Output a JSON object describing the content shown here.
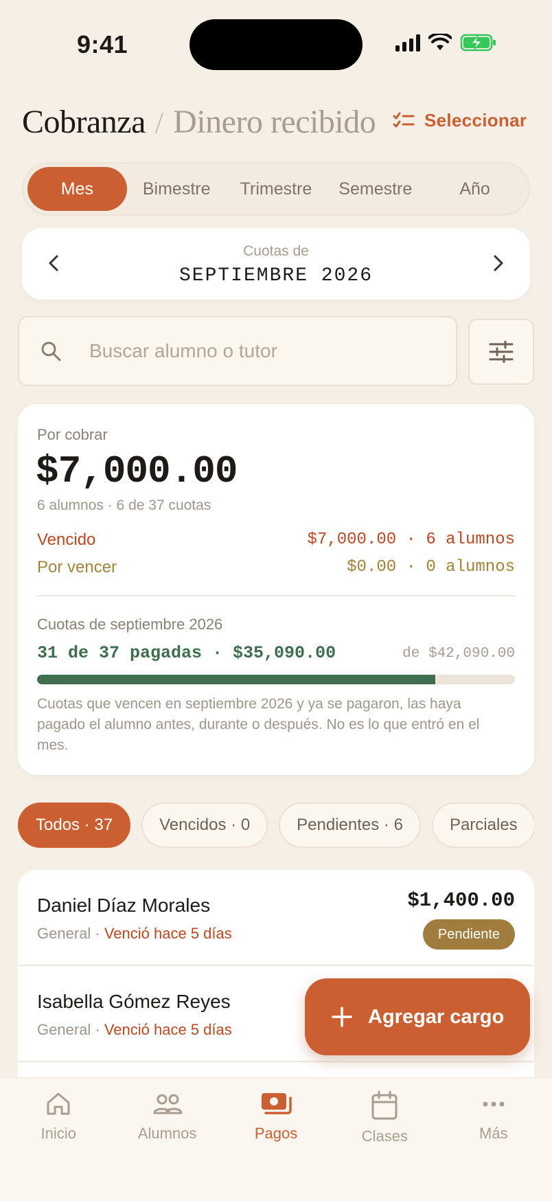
{
  "status_bar": {
    "time": "9:41"
  },
  "header": {
    "title": "Cobranza",
    "separator": "/",
    "subtitle": "Dinero recibido",
    "select_label": "Seleccionar"
  },
  "segments": [
    {
      "label": "Mes",
      "active": true
    },
    {
      "label": "Bimestre",
      "active": false
    },
    {
      "label": "Trimestre",
      "active": false
    },
    {
      "label": "Semestre",
      "active": false
    },
    {
      "label": "Año",
      "active": false
    }
  ],
  "period": {
    "label": "Cuotas de",
    "value": "SEPTIEMBRE 2026"
  },
  "search": {
    "placeholder": "Buscar alumno o tutor",
    "value": ""
  },
  "summary": {
    "label": "Por cobrar",
    "amount": "$7,000.00",
    "sub": "6 alumnos · 6 de 37 cuotas",
    "overdue_label": "Vencido",
    "overdue_value": "$7,000.00 · 6 alumnos",
    "upcoming_label": "Por vencer",
    "upcoming_value": "$0.00 · 0 alumnos",
    "cuotas_label": "Cuotas de septiembre 2026",
    "progress_text": "31 de 37 pagadas · $35,090.00",
    "progress_total": "de $42,090.00",
    "progress_fraction": 0.8337,
    "note": "Cuotas que vencen en septiembre 2026 y ya se pagaron, las haya pagado el alumno antes, durante o después. No es lo que entró en el mes."
  },
  "chips": [
    {
      "label": "Todos · 37",
      "active": true
    },
    {
      "label": "Vencidos · 0",
      "active": false
    },
    {
      "label": "Pendientes · 6",
      "active": false
    },
    {
      "label": "Parciales",
      "active": false
    }
  ],
  "list": [
    {
      "name": "Daniel Díaz Morales",
      "group": "General · ",
      "status": "Venció hace 5 días",
      "amount": "$1,400.00",
      "badge": "Pendiente"
    },
    {
      "name": "Isabella Gómez Reyes",
      "group": "General · ",
      "status": "Venció hace 5 días",
      "amount": "",
      "badge": ""
    }
  ],
  "fab": {
    "label": "Agregar cargo"
  },
  "tabbar": [
    {
      "label": "Inicio",
      "icon": "home-icon",
      "active": false
    },
    {
      "label": "Alumnos",
      "icon": "users-icon",
      "active": false
    },
    {
      "label": "Pagos",
      "icon": "payments-icon",
      "active": true
    },
    {
      "label": "Clases",
      "icon": "calendar-icon",
      "active": false
    },
    {
      "label": "Más",
      "icon": "more-icon",
      "active": false
    }
  ],
  "colors": {
    "accent": "#cc5f31",
    "background": "#f5efe6",
    "overdue": "#c0461f",
    "upcoming": "#a68237",
    "paid": "#3e6e4e",
    "badge": "#a07c3f"
  }
}
